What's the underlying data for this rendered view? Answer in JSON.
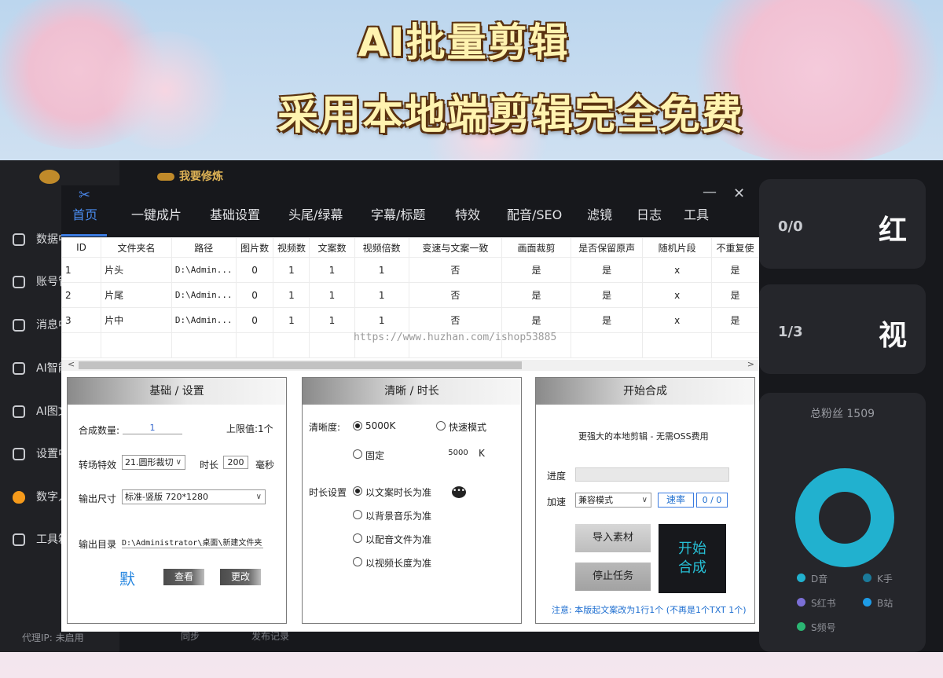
{
  "banner": {
    "headline_1": "AI批量剪辑",
    "headline_2": "采用本地端剪辑完全免费"
  },
  "background_app": {
    "brand": "我要修炼",
    "sidebar_items": [
      "数据中心",
      "账号管理",
      "消息中心",
      "AI智能",
      "AI图文",
      "设置中心",
      "数字人",
      "工具箱"
    ],
    "proxy_ip": "代理IP: 未启用",
    "bottom_links": [
      "同步",
      "发布记录"
    ],
    "card_1": {
      "count": "0/0",
      "platform": "红"
    },
    "card_2": {
      "count": "1/3",
      "platform": "视"
    },
    "fans": {
      "title": "总粉丝 1509",
      "legend": [
        {
          "label": "D音",
          "color": "#21b1cf"
        },
        {
          "label": "K手",
          "color": "#1b7a9a"
        },
        {
          "label": "S红书",
          "color": "#7b6fd6"
        },
        {
          "label": "B站",
          "color": "#1e9be6"
        },
        {
          "label": "S频号",
          "color": "#2bb673"
        }
      ]
    }
  },
  "window": {
    "tabs": [
      "首页",
      "一键成片",
      "基础设置",
      "头尾/绿幕",
      "字幕/标题",
      "特效",
      "配音/SEO",
      "滤镜",
      "日志",
      "工具"
    ],
    "active_tab": "首页",
    "minimize": "—",
    "close": "✕",
    "table": {
      "columns": [
        "ID",
        "文件夹名",
        "路径",
        "图片数",
        "视频数",
        "文案数",
        "视频倍数",
        "变速与文案一致",
        "画面裁剪",
        "是否保留原声",
        "随机片段",
        "不重复使"
      ],
      "rows": [
        [
          "1",
          "片头",
          "D:\\Admin...",
          "0",
          "1",
          "1",
          "1",
          "否",
          "是",
          "是",
          "x",
          "是"
        ],
        [
          "2",
          "片尾",
          "D:\\Admin...",
          "0",
          "1",
          "1",
          "1",
          "否",
          "是",
          "是",
          "x",
          "是"
        ],
        [
          "3",
          "片中",
          "D:\\Admin...",
          "0",
          "1",
          "1",
          "1",
          "否",
          "是",
          "是",
          "x",
          "是"
        ]
      ]
    },
    "watermark": "https://www.huzhan.com/ishop53885",
    "basic": {
      "title": "基础 / 设置",
      "count_label": "合成数量:",
      "count_value": "1",
      "limit_text": "上限值:1个",
      "transition_label": "转场特效",
      "transition_value": "21.圆形裁切",
      "duration_label": "时长",
      "duration_value": "200",
      "duration_unit": "毫秒",
      "size_label": "输出尺寸",
      "size_value": "标准-竖版 720*1280",
      "dir_label": "输出目录",
      "dir_value": "D:\\Administrator\\桌面\\新建文件夹",
      "default_btn": "默",
      "view_btn": "查看",
      "change_btn": "更改"
    },
    "clarity": {
      "title": "清晰 / 时长",
      "clarity_label": "清晰度:",
      "opt_5000k": "5000K",
      "opt_fast": "快速模式",
      "opt_fixed": "固定",
      "fixed_value": "5000",
      "fixed_unit": "K",
      "duration_label": "时长设置",
      "duration_options": [
        "以文案时长为准",
        "以背景音乐为准",
        "以配音文件为准",
        "以视频长度为准"
      ]
    },
    "start": {
      "title": "开始合成",
      "subtitle": "更强大的本地剪辑 - 无需OSS费用",
      "progress_label": "进度",
      "progress_value": 0,
      "speed_label": "加速",
      "speed_value": "兼容模式",
      "rate_label": "速率",
      "rate_value": "0 / 0",
      "import_btn": "导入素材",
      "stop_btn": "停止任务",
      "start_btn_1": "开始",
      "start_btn_2": "合成",
      "note": "注意: 本版起文案改为1行1个 (不再是1个TXT 1个)"
    }
  }
}
